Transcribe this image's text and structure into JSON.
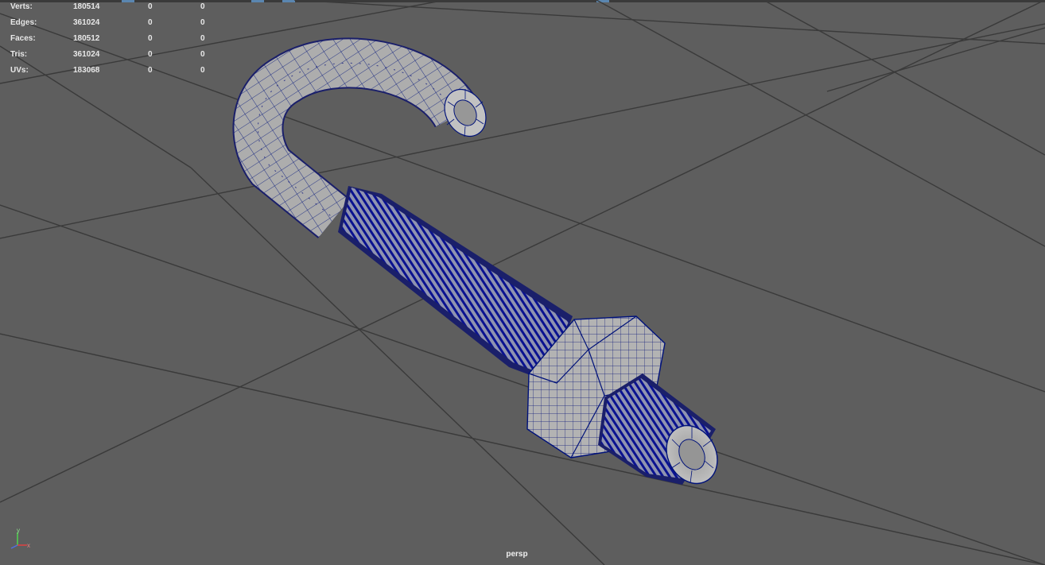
{
  "hud": {
    "rows": [
      {
        "label": "Verts:",
        "v1": "180514",
        "v2": "0",
        "v3": "0"
      },
      {
        "label": "Edges:",
        "v1": "361024",
        "v2": "0",
        "v3": "0"
      },
      {
        "label": "Faces:",
        "v1": "180512",
        "v2": "0",
        "v3": "0"
      },
      {
        "label": "Tris:",
        "v1": "361024",
        "v2": "0",
        "v3": "0"
      },
      {
        "label": "UVs:",
        "v1": "183068",
        "v2": "0",
        "v3": "0"
      }
    ]
  },
  "viewport": {
    "camera_name": "persp"
  },
  "axis": {
    "y": "y",
    "x": "x"
  },
  "colors": {
    "background": "#5e5e5e",
    "grid": "#3c3c3c",
    "mesh_surface": "#a9a9a9",
    "wireframe": "#000a78"
  }
}
